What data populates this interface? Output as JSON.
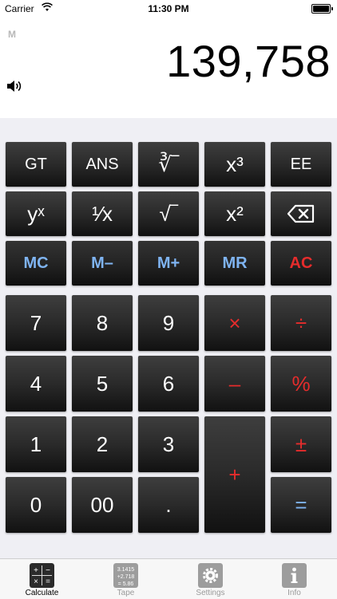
{
  "status_bar": {
    "carrier": "Carrier",
    "time": "11:30 PM"
  },
  "display": {
    "memory_indicator": "M",
    "value": "139,758"
  },
  "keys": {
    "gt": "GT",
    "ans": "ANS",
    "cube_root": "∛‾",
    "cube": "x³",
    "ee": "EE",
    "power": "yˣ",
    "reciprocal": "¹⁄x",
    "sqrt": "√‾",
    "square": "x²",
    "mc": "MC",
    "m_minus": "M–",
    "m_plus": "M+",
    "mr": "MR",
    "ac": "AC",
    "d7": "7",
    "d8": "8",
    "d9": "9",
    "multiply": "×",
    "divide": "÷",
    "d4": "4",
    "d5": "5",
    "d6": "6",
    "minus": "–",
    "percent": "%",
    "d1": "1",
    "d2": "2",
    "d3": "3",
    "plus": "+",
    "plus_minus": "±",
    "d0": "0",
    "d00": "00",
    "decimal": ".",
    "equals": "="
  },
  "tabs": [
    {
      "label": "Calculate",
      "icon": "calculator-icon",
      "active": true
    },
    {
      "label": "Tape",
      "icon": "tape-icon",
      "active": false,
      "icon_text": [
        "3.1415",
        "+2.718",
        "= 5.86"
      ]
    },
    {
      "label": "Settings",
      "icon": "gear-icon",
      "active": false
    },
    {
      "label": "Info",
      "icon": "info-icon",
      "active": false
    }
  ],
  "colors": {
    "accent_red": "#e62c2c",
    "memory_blue": "#7fb4f2",
    "key_dark": "#2a2a2a"
  }
}
